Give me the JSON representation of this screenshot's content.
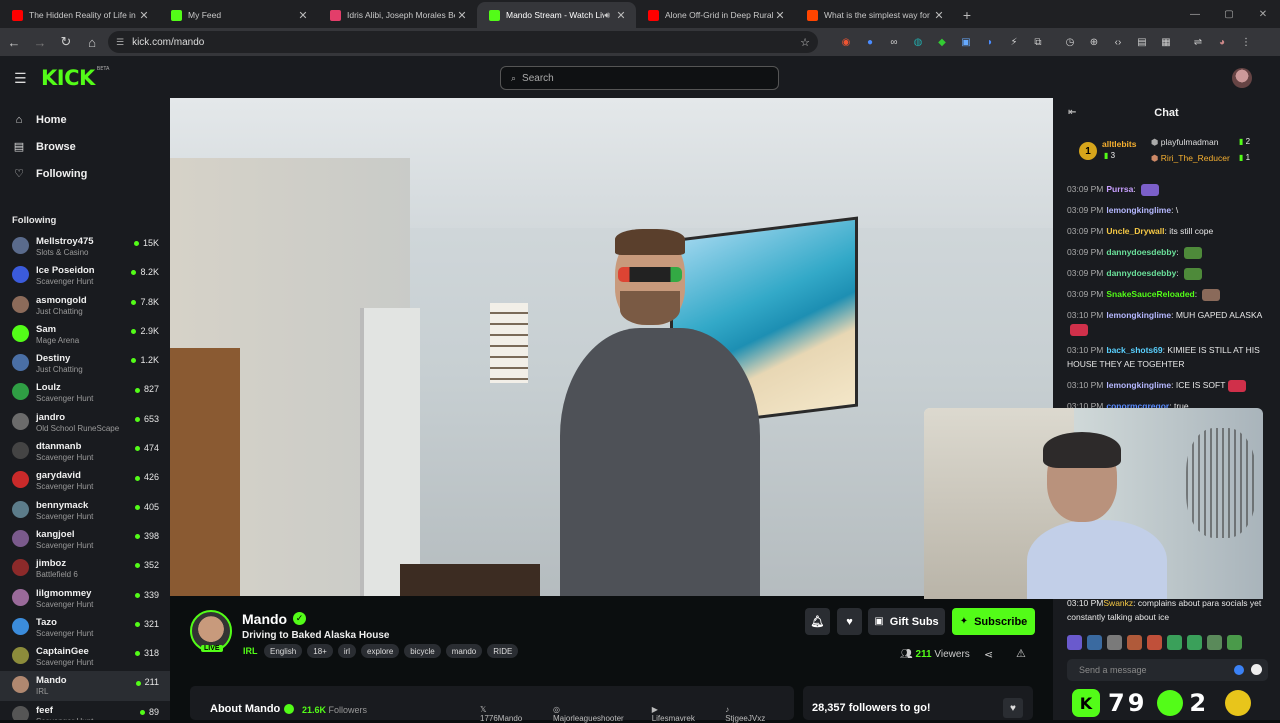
{
  "browser": {
    "tabs": [
      {
        "title": "The Hidden Reality of Life in Pu",
        "favicon_color": "#ff0000",
        "active": false
      },
      {
        "title": "My Feed",
        "favicon_color": "#53fc18",
        "active": false
      },
      {
        "title": "Idris Alibi, Joseph Morales Bett",
        "favicon_color": "#e33e6a",
        "active": false
      },
      {
        "title": "Mando Stream - Watch Live",
        "favicon_color": "#53fc18",
        "active": true
      },
      {
        "title": "Alone Off-Grid in Deep Rural C",
        "favicon_color": "#ff0000",
        "active": false
      },
      {
        "title": "What is the simplest way for a",
        "favicon_color": "#ff4500",
        "active": false
      }
    ],
    "url": "kick.com/mando"
  },
  "header": {
    "logo": "KICK",
    "logo_sup": "BETA",
    "search_placeholder": "Search"
  },
  "sidebar": {
    "nav": [
      {
        "label": "Home",
        "icon": "home-icon"
      },
      {
        "label": "Browse",
        "icon": "browse-icon"
      },
      {
        "label": "Following",
        "icon": "heart-icon"
      }
    ],
    "following_heading": "Following",
    "channels": [
      {
        "name": "Mellstroy475",
        "category": "Slots & Casino",
        "viewers": "15K",
        "color": "#5a6b8c"
      },
      {
        "name": "Ice Poseidon",
        "category": "Scavenger Hunt",
        "viewers": "8.2K",
        "color": "#3b5bdb"
      },
      {
        "name": "asmongold",
        "category": "Just Chatting",
        "viewers": "7.8K",
        "color": "#8c6b5a"
      },
      {
        "name": "Sam",
        "category": "Mage Arena",
        "viewers": "2.9K",
        "color": "#53fc18"
      },
      {
        "name": "Destiny",
        "category": "Just Chatting",
        "viewers": "1.2K",
        "color": "#4a6fa5"
      },
      {
        "name": "Loulz",
        "category": "Scavenger Hunt",
        "viewers": "827",
        "color": "#2f9e44"
      },
      {
        "name": "jandro",
        "category": "Old School RuneScape",
        "viewers": "653",
        "color": "#6b6b6b"
      },
      {
        "name": "dtanmanb",
        "category": "Scavenger Hunt",
        "viewers": "474",
        "color": "#444444"
      },
      {
        "name": "garydavid",
        "category": "Scavenger Hunt",
        "viewers": "426",
        "color": "#c92a2a"
      },
      {
        "name": "bennymack",
        "category": "Scavenger Hunt",
        "viewers": "405",
        "color": "#5c7c8a"
      },
      {
        "name": "kangjoel",
        "category": "Scavenger Hunt",
        "viewers": "398",
        "color": "#7a5a8c"
      },
      {
        "name": "jimboz",
        "category": "Battlefield 6",
        "viewers": "352",
        "color": "#8c2a2a"
      },
      {
        "name": "lilgmommey",
        "category": "Scavenger Hunt",
        "viewers": "339",
        "color": "#9a6a9a"
      },
      {
        "name": "Tazo",
        "category": "Scavenger Hunt",
        "viewers": "321",
        "color": "#3b8cdb"
      },
      {
        "name": "CaptainGee",
        "category": "Scavenger Hunt",
        "viewers": "318",
        "color": "#8c8c3b"
      },
      {
        "name": "Mando",
        "category": "IRL",
        "viewers": "211",
        "color": "#b08870",
        "active": true
      },
      {
        "name": "feef",
        "category": "Scavenger Hunt",
        "viewers": "89",
        "color": "#555555"
      }
    ]
  },
  "stream": {
    "streamer": "Mando",
    "title": "Driving to Baked Alaska House",
    "category": "IRL",
    "tags": [
      "English",
      "18+",
      "irl",
      "explore",
      "bicycle",
      "mando",
      "RIDE"
    ],
    "live_label": "LIVE",
    "viewers": "211",
    "viewers_label": "Viewers",
    "gift_label": "Gift Subs",
    "subscribe_label": "Subscribe",
    "about_title": "About Mando",
    "followers": "21.6K",
    "followers_label": "Followers",
    "socials": [
      "1776Mando",
      "Majorleagueshooter",
      "Lifesmavrek",
      "StjgeeJVxz"
    ],
    "goal_text": "28,357 followers to go!"
  },
  "chat": {
    "title": "Chat",
    "pinned": {
      "top_gifter": "alltlebits",
      "top_gifter_count": "3",
      "user2": "playfulmadman",
      "user2_count": "2",
      "user3": "Riri_The_Reducer",
      "user3_count": "1",
      "rank_badge": "1"
    },
    "messages": [
      {
        "time": "03:09 PM",
        "user": "Purrsa",
        "text": "",
        "color": "#c8a0ff",
        "emote": "#7b5fc9"
      },
      {
        "time": "03:09 PM",
        "user": "lemongkinglime",
        "text": "\\",
        "color": "#b5b8ff",
        "emote": ""
      },
      {
        "time": "03:09 PM",
        "user": "Uncle_Drywall",
        "text": "its still cope",
        "color": "#f6c945",
        "emote": ""
      },
      {
        "time": "03:09 PM",
        "user": "dannydoesdebby",
        "text": "",
        "color": "#6be09a",
        "emote": "#4e8a3a"
      },
      {
        "time": "03:09 PM",
        "user": "dannydoesdebby",
        "text": "",
        "color": "#6be09a",
        "emote": "#4e8a3a"
      },
      {
        "time": "03:09 PM",
        "user": "SnakeSauceReloaded",
        "text": "",
        "color": "#53fc18",
        "emote": "#8a6a5a"
      },
      {
        "time": "03:10 PM",
        "user": "lemongkinglime",
        "text": "MUH GAPED ALASKA",
        "color": "#b5b8ff",
        "emote": "#d0304a"
      },
      {
        "time": "03:10 PM",
        "user": "back_shots69",
        "text": "KIMIEE IS STILL AT HIS HOUSE THEY AE TOGEHTER",
        "color": "#5ad1ff",
        "emote": ""
      },
      {
        "time": "03:10 PM",
        "user": "lemongkinglime",
        "text": "ICE IS SOFT",
        "color": "#b5b8ff",
        "emote": "#d0304a"
      },
      {
        "time": "03:10 PM",
        "user": "conormcgregor",
        "text": "true",
        "color": "#5a8cff",
        "emote": ""
      }
    ],
    "last_message": {
      "time": "03:10 PM",
      "user": "Swankz",
      "text": "complains about para socials yet constantly talking about ice",
      "color": "#f6c945"
    },
    "input_placeholder": "Send a message"
  },
  "overlay": {
    "count1": "79",
    "count2": "2"
  }
}
